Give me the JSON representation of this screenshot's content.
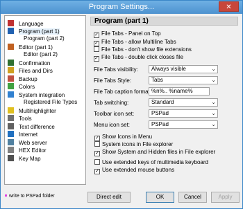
{
  "window": {
    "title": "Program Settings...",
    "close_glyph": "✕"
  },
  "tree": {
    "items": [
      {
        "label": "Language",
        "icon": "flag-icon",
        "color": "#c03030"
      },
      {
        "label": "Program  (part 1)",
        "icon": "window-icon",
        "color": "#2060b0"
      },
      {
        "label": "Program  (part 2)",
        "sub": true
      },
      {
        "label": "Editor  (part 1)",
        "icon": "pencil-icon",
        "color": "#c06020"
      },
      {
        "label": "Editor  (part 2)",
        "sub": true
      },
      {
        "label": "Confirmation",
        "icon": "check-icon",
        "color": "#307030"
      },
      {
        "label": "Files and Dirs",
        "icon": "folder-icon",
        "color": "#d0a020"
      },
      {
        "label": "Backup",
        "icon": "disk-icon",
        "color": "#c05040"
      },
      {
        "label": "Colors",
        "icon": "palette-icon",
        "color": "#40a040"
      },
      {
        "label": "System integration",
        "icon": "windows-icon",
        "color": "#3080d0"
      },
      {
        "label": "Registered File Types",
        "sub": true
      },
      {
        "label": "Multihighlighter",
        "icon": "highlighter-icon",
        "color": "#e0c020"
      },
      {
        "label": "Tools",
        "icon": "gear-icon",
        "color": "#707070"
      },
      {
        "label": "Text difference",
        "icon": "diff-icon",
        "color": "#606060"
      },
      {
        "label": "Internet",
        "icon": "globe-icon",
        "color": "#2070c0"
      },
      {
        "label": "Web server",
        "icon": "server-icon",
        "color": "#5080a0"
      },
      {
        "label": "HEX Editor",
        "icon": "hex-icon",
        "color": "#808080"
      },
      {
        "label": "Key Map",
        "icon": "keyboard-icon",
        "color": "#505050"
      }
    ]
  },
  "footer": {
    "note": "write to PSPad folder"
  },
  "panel": {
    "title": "Program  (part 1)",
    "checks_top": [
      {
        "label": "File Tabs - Panel on Top",
        "checked": true
      },
      {
        "label": "File Tabs - allow Multiline Tabs",
        "checked": true
      },
      {
        "label": "File Tabs - don't show file extensions",
        "checked": false
      },
      {
        "label": "File Tabs - double click closes file",
        "checked": true
      }
    ],
    "fields": {
      "visibility": {
        "label": "File Tabs visibility:",
        "value": "Always visible"
      },
      "style": {
        "label": "File Tabs Style:",
        "value": "Tabs"
      },
      "caption": {
        "label": "File Tab caption format:",
        "value": "%n%.. %name%"
      },
      "switching": {
        "label": "Tab switching:",
        "value": "Standard"
      },
      "toolbar_icons": {
        "label": "Toolbar icon set:",
        "value": "PSPad"
      },
      "menu_icons": {
        "label": "Menu icon set:",
        "value": "PSPad"
      }
    },
    "checks_mid": [
      {
        "label": "Show Icons in Menu",
        "checked": true
      },
      {
        "label": "System icons in File explorer",
        "checked": false
      },
      {
        "label": "Show System and Hidden files in File explorer",
        "checked": true
      }
    ],
    "checks_bottom": [
      {
        "label": "Use extended keys of multimedia keyboard",
        "checked": false
      },
      {
        "label": "Use extended mouse buttons",
        "checked": true
      }
    ]
  },
  "buttons": {
    "direct_edit": "Direct edit",
    "ok": "OK",
    "cancel": "Cancel",
    "apply": "Apply"
  }
}
